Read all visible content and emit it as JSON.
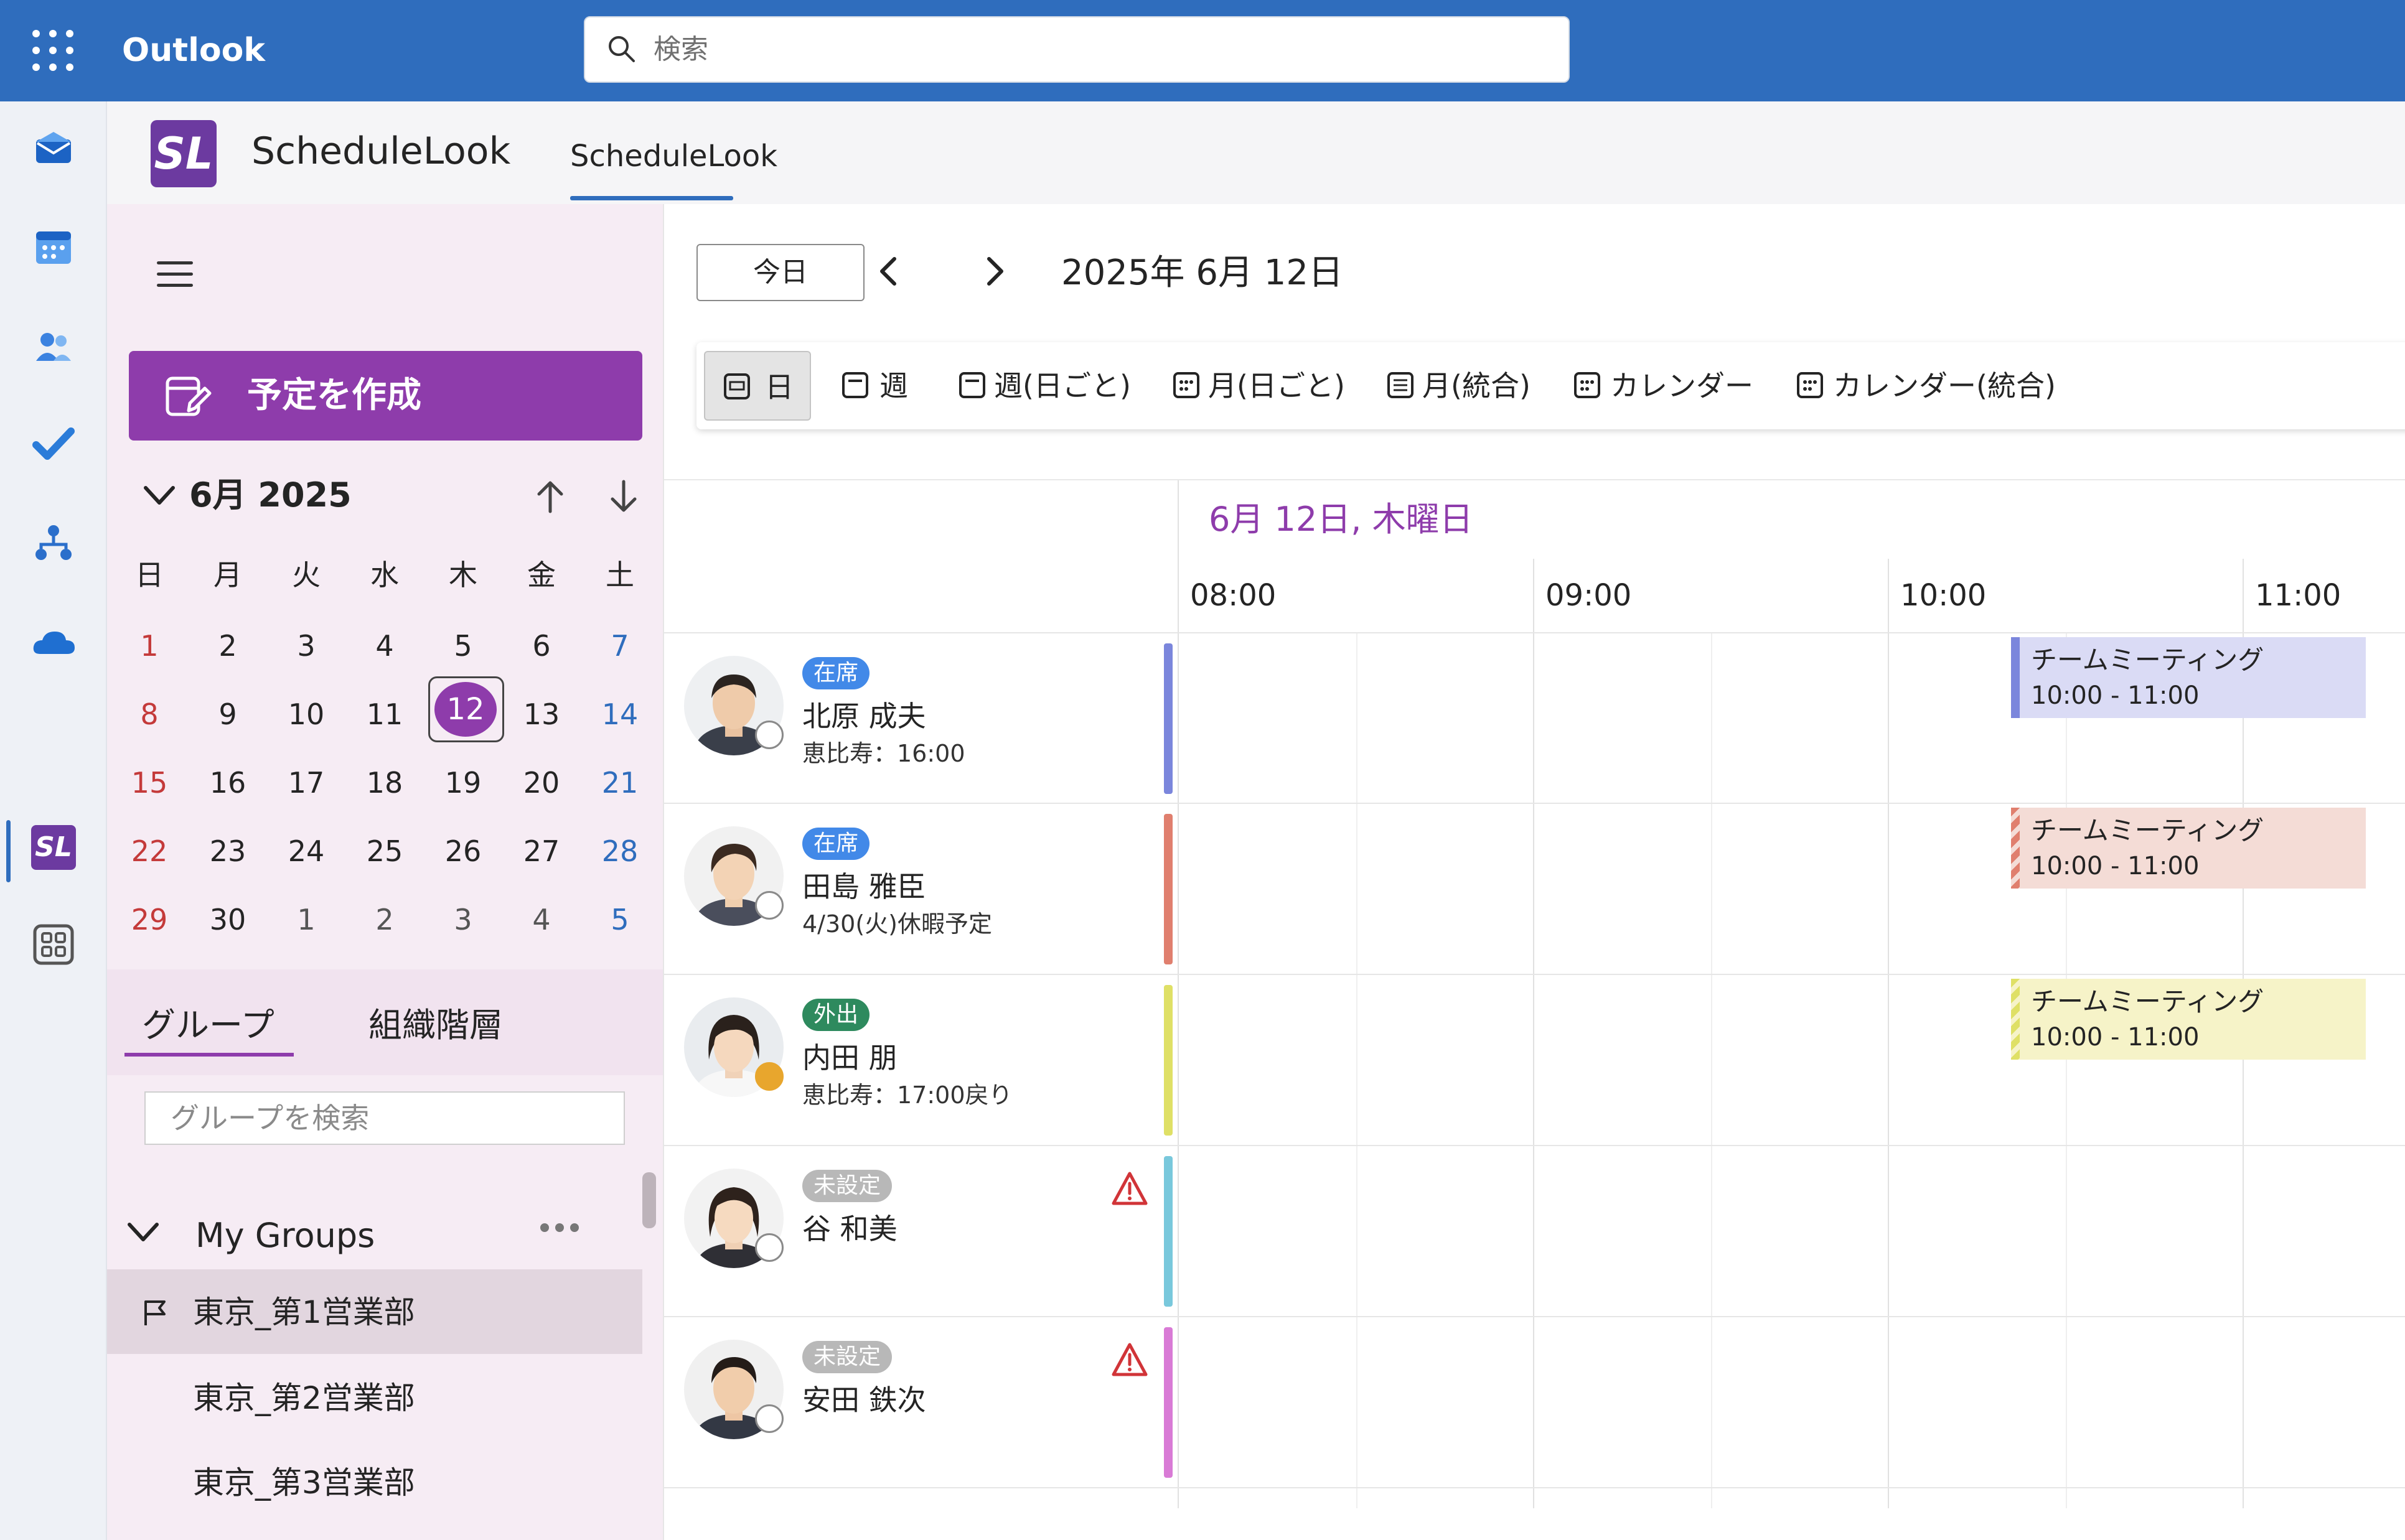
{
  "topbar": {
    "app_name": "Outlook",
    "search_placeholder": "検索"
  },
  "app": {
    "name": "ScheduleLook",
    "tab": "ScheduleLook",
    "logo_text": "SL"
  },
  "sidebar": {
    "create_button": "予定を作成",
    "mini_calendar": {
      "month_label": "6月 2025",
      "weekdays": [
        "日",
        "月",
        "火",
        "水",
        "木",
        "金",
        "土"
      ],
      "weeks": [
        [
          "1",
          "2",
          "3",
          "4",
          "5",
          "6",
          "7"
        ],
        [
          "8",
          "9",
          "10",
          "11",
          "12",
          "13",
          "14"
        ],
        [
          "15",
          "16",
          "17",
          "18",
          "19",
          "20",
          "21"
        ],
        [
          "22",
          "23",
          "24",
          "25",
          "26",
          "27",
          "28"
        ],
        [
          "29",
          "30",
          "1",
          "2",
          "3",
          "4",
          "5"
        ]
      ],
      "selected_day": "12"
    },
    "tabs": [
      "グループ",
      "組織階層"
    ],
    "group_search_placeholder": "グループを検索",
    "my_groups_label": "My Groups",
    "groups": [
      "東京_第1営業部",
      "東京_第2営業部",
      "東京_第3営業部"
    ]
  },
  "toolbar": {
    "today": "今日",
    "date": "2025年 6月 12日",
    "views": [
      "日",
      "週",
      "週(日ごと)",
      "月(日ごと)",
      "月(統合)",
      "カレンダー",
      "カレンダー(統合)"
    ]
  },
  "schedule": {
    "date_header": "6月 12日, 木曜日",
    "times": [
      "08:00",
      "09:00",
      "10:00",
      "11:00"
    ],
    "people": [
      {
        "status": "在席",
        "name": "北原 成夫",
        "note": "恵比寿：16:00",
        "color": "#7b86dc",
        "event": {
          "title": "チームミーティング",
          "time": "10:00 - 11:00",
          "bg": "#dadbf5",
          "bar": "#7b86dc"
        }
      },
      {
        "status": "在席",
        "name": "田島 雅臣",
        "note": "4/30(火)休暇予定",
        "color": "#e07f6e",
        "event": {
          "title": "チームミーティング",
          "time": "10:00 - 11:00",
          "bg": "#f4dcd6",
          "bar": "#e07f6e"
        }
      },
      {
        "status": "外出",
        "name": "内田 朋",
        "note": "恵比寿：17:00戻り",
        "color": "#dfe066",
        "event": {
          "title": "チームミーティング",
          "time": "10:00 - 11:00",
          "bg": "#f6f3c8",
          "bar": "#dfe066"
        }
      },
      {
        "status": "未設定",
        "name": "谷 和美",
        "note": "",
        "color": "#79c8dc"
      },
      {
        "status": "未設定",
        "name": "安田 鉄次",
        "note": "",
        "color": "#d97bd6"
      }
    ]
  },
  "colors": {
    "brand_blue": "#2f6dbd",
    "accent_purple": "#8e3cab",
    "warning_red": "#d13438"
  }
}
